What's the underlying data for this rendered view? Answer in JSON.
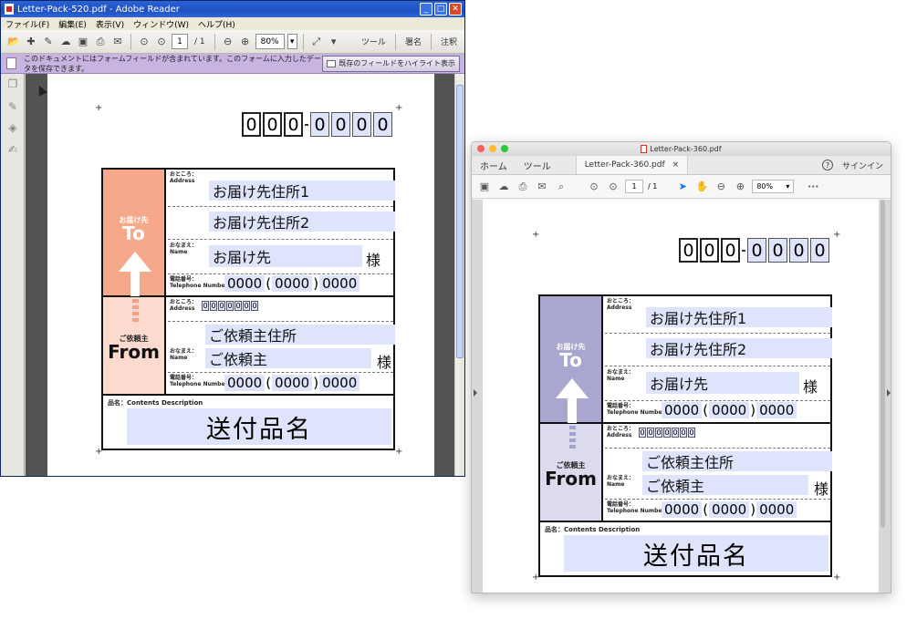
{
  "win": {
    "title": "Letter-Pack-520.pdf - Adobe Reader",
    "menu": [
      "ファイル(F)",
      "編集(E)",
      "表示(V)",
      "ウィンドウ(W)",
      "ヘルプ(H)"
    ],
    "page_current": "1",
    "page_total": "/ 1",
    "zoom": "80%",
    "tools": "ツール",
    "sign": "署名",
    "comment": "注釈",
    "form_message": "このドキュメントにはフォームフィールドが含まれています。このフォームに入力したデータを保存できます。",
    "highlight_button": "既存のフィールドをハイライト表示"
  },
  "mac": {
    "title": "Letter-Pack-360.pdf",
    "home": "ホーム",
    "tools": "ツール",
    "tab": "Letter-Pack-360.pdf",
    "tab_close": "×",
    "help": "?",
    "signin": "サインイン",
    "page_current": "1",
    "page_total": "/ 1",
    "zoom": "80%",
    "more": "•••"
  },
  "form": {
    "zip_digits": [
      "0",
      "0",
      "0",
      "0",
      "0",
      "0",
      "0"
    ],
    "to_small": "お届け先",
    "to_big": "To",
    "from_small": "ご依頼主",
    "from_big": "From",
    "address_label": "おところ：",
    "address_label_en": "Address",
    "name_label": "おなまえ：",
    "name_label_en": "Name",
    "tel_label": "電話番号：",
    "tel_label_en": "Telephone Number",
    "to_address1": "お届け先住所1",
    "to_address2": "お届け先住所2",
    "to_name": "お届け先",
    "sama": "様",
    "tel_a": "0000",
    "tel_b": "0000",
    "tel_c": "0000",
    "paren_open": "(",
    "paren_close": ")",
    "from_zip": [
      "0",
      "0",
      "0",
      "0",
      "0",
      "0",
      "0"
    ],
    "from_address": "ご依頼主住所",
    "from_name": "ご依頼主",
    "item_label": "品名：Contents Description",
    "item_value": "送付品名"
  },
  "colors": {
    "to_side_520": "#f6a88b",
    "from_side_520": "#fcdacd",
    "from_accent_520": "#f3a185",
    "to_side_360": "#a9a6d0",
    "from_side_360": "#dcdbee",
    "from_accent_360": "#a4a1cd",
    "field_bg": "#dde4fb",
    "form_bar": "#c8b4e0"
  }
}
